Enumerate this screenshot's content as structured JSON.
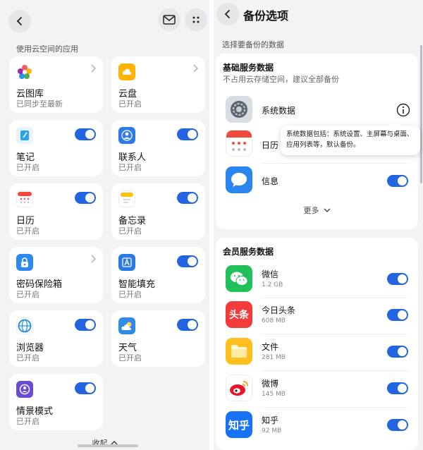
{
  "left": {
    "section_label": "使用云空间的应用",
    "apps": [
      {
        "name": "云图库",
        "status": "已同步至最新",
        "control": "chevron",
        "icon": "gallery-icon"
      },
      {
        "name": "云盘",
        "status": "已开启",
        "control": "chevron",
        "icon": "cloud-drive-icon"
      },
      {
        "name": "笔记",
        "status": "已开启",
        "control": "toggle",
        "icon": "notes-icon"
      },
      {
        "name": "联系人",
        "status": "已开启",
        "control": "toggle",
        "icon": "contacts-icon"
      },
      {
        "name": "日历",
        "status": "已开启",
        "control": "toggle",
        "icon": "calendar-icon"
      },
      {
        "name": "备忘录",
        "status": "已开启",
        "control": "toggle",
        "icon": "memo-icon"
      },
      {
        "name": "密码保险箱",
        "status": "已开启",
        "control": "chevron",
        "icon": "password-vault-icon"
      },
      {
        "name": "智能填充",
        "status": "已开启",
        "control": "toggle",
        "icon": "autofill-icon"
      },
      {
        "name": "浏览器",
        "status": "已开启",
        "control": "toggle",
        "icon": "browser-icon"
      },
      {
        "name": "天气",
        "status": "已开启",
        "control": "toggle",
        "icon": "weather-icon"
      },
      {
        "name": "情景模式",
        "status": "已开启",
        "control": "toggle",
        "icon": "scene-mode-icon"
      }
    ],
    "collapse_label": "收起"
  },
  "right": {
    "title": "备份选项",
    "section_label": "选择要备份的数据",
    "basic": {
      "title": "基础服务数据",
      "subtitle": "不占用云存储空间，建议全部备份",
      "items": [
        {
          "name": "系统数据",
          "control": "info",
          "icon": "settings-gear-icon"
        },
        {
          "name": "日历",
          "control": "toggle",
          "icon": "calendar-icon"
        },
        {
          "name": "信息",
          "control": "toggle",
          "icon": "messages-icon"
        }
      ],
      "more_label": "更多"
    },
    "tooltip": "系统数据包括：系统设置、主屏幕与桌面、应用列表等，默认备份。",
    "member": {
      "title": "会员服务数据",
      "items": [
        {
          "name": "微信",
          "size": "1.2 GB",
          "icon": "wechat-icon",
          "glyph": ""
        },
        {
          "name": "今日头条",
          "size": "608 MB",
          "icon": "toutiao-icon",
          "glyph": "头条"
        },
        {
          "name": "文件",
          "size": "281 MB",
          "icon": "files-icon",
          "glyph": ""
        },
        {
          "name": "微博",
          "size": "145 MB",
          "icon": "weibo-icon",
          "glyph": ""
        },
        {
          "name": "知乎",
          "size": "92 MB",
          "icon": "zhihu-icon",
          "glyph": "知乎"
        }
      ]
    }
  },
  "colors": {
    "accent": "#2364e0",
    "panel_bg": "#f1f3f5",
    "card_bg": "#ffffff"
  }
}
